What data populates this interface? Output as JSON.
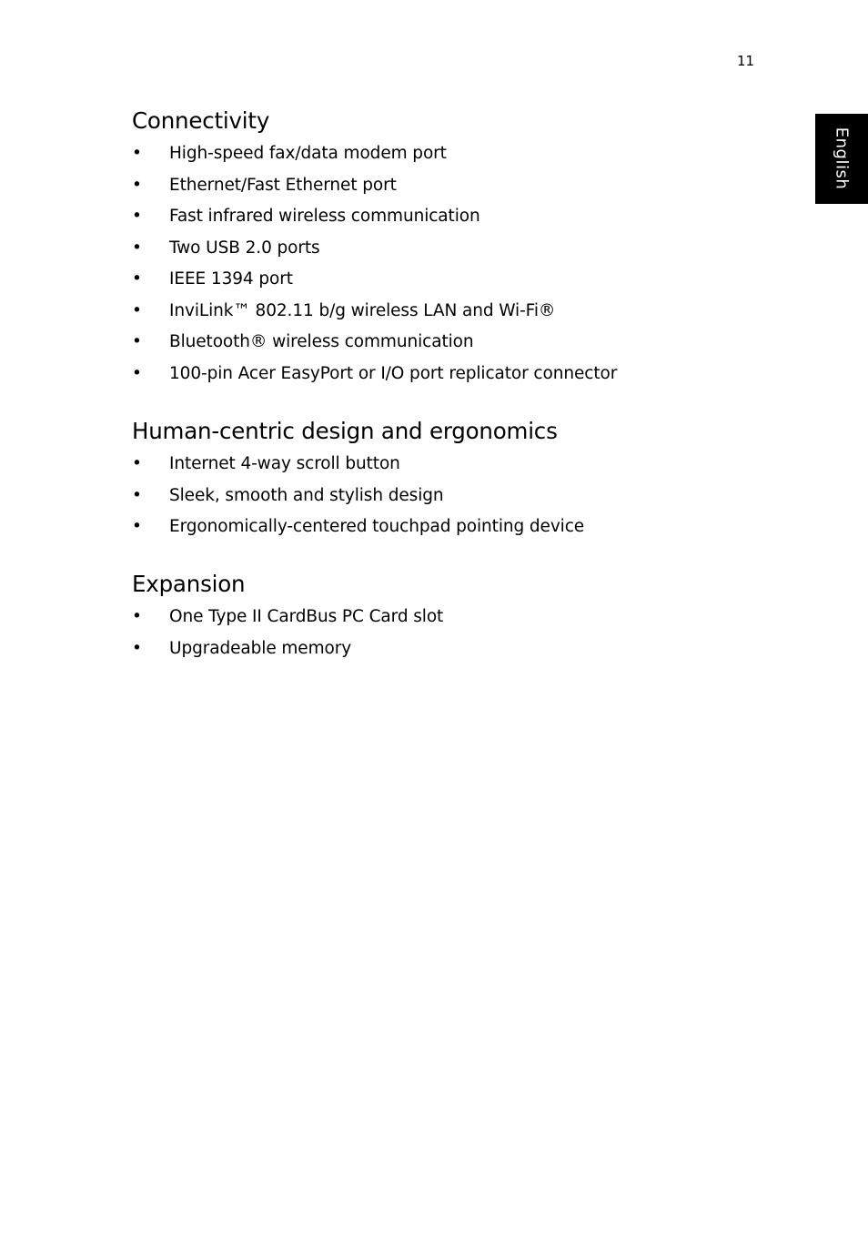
{
  "page_number": "11",
  "language_tab": "English",
  "bullet_glyph": "•",
  "sections": [
    {
      "heading": "Connectivity",
      "items": [
        "High-speed fax/data modem port",
        "Ethernet/Fast Ethernet port",
        "Fast infrared wireless communication",
        "Two USB 2.0 ports",
        "IEEE 1394 port",
        "InviLink™ 802.11 b/g wireless LAN and Wi-Fi®",
        "Bluetooth® wireless communication",
        "100-pin Acer EasyPort or I/O port replicator connector"
      ]
    },
    {
      "heading": "Human-centric design and ergonomics",
      "items": [
        "Internet 4-way scroll button",
        "Sleek, smooth and stylish design",
        "Ergonomically-centered touchpad pointing device"
      ]
    },
    {
      "heading": "Expansion",
      "items": [
        "One Type II CardBus PC Card slot",
        "Upgradeable memory"
      ]
    }
  ]
}
